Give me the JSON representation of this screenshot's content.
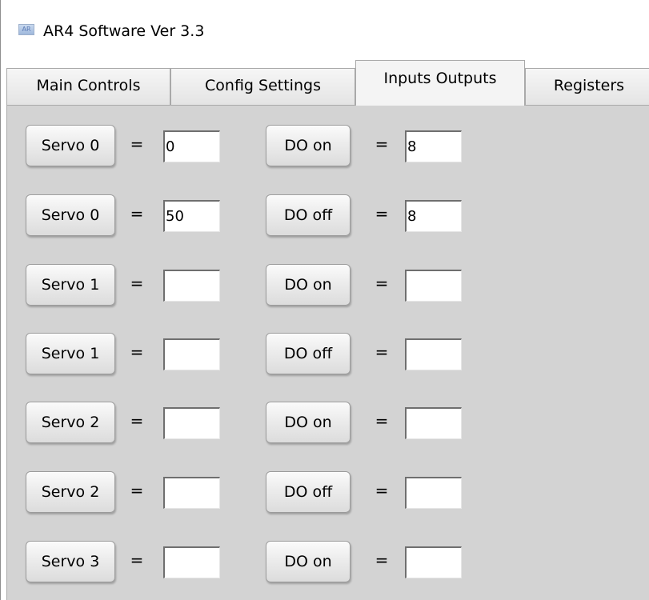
{
  "window": {
    "title": "AR4 Software Ver 3.3",
    "icon": "ar4-app-icon"
  },
  "tabs": [
    {
      "label": "Main Controls",
      "active": false
    },
    {
      "label": "Config Settings",
      "active": false
    },
    {
      "label": "Inputs Outputs",
      "active": true
    },
    {
      "label": "Registers",
      "active": false
    }
  ],
  "equals_sign": "=",
  "rows": [
    {
      "servo_label": "Servo 0",
      "servo_value": "0",
      "do_label": "DO on",
      "do_value": "8"
    },
    {
      "servo_label": "Servo 0",
      "servo_value": "50",
      "do_label": "DO off",
      "do_value": "8"
    },
    {
      "servo_label": "Servo 1",
      "servo_value": "",
      "do_label": "DO on",
      "do_value": ""
    },
    {
      "servo_label": "Servo 1",
      "servo_value": "",
      "do_label": "DO off",
      "do_value": ""
    },
    {
      "servo_label": "Servo 2",
      "servo_value": "",
      "do_label": "DO on",
      "do_value": ""
    },
    {
      "servo_label": "Servo 2",
      "servo_value": "",
      "do_label": "DO off",
      "do_value": ""
    },
    {
      "servo_label": "Servo 3",
      "servo_value": "",
      "do_label": "DO on",
      "do_value": ""
    }
  ],
  "colors": {
    "panel_background": "#d3d3d3",
    "button_face": "#ececec",
    "field_background": "#ffffff"
  }
}
